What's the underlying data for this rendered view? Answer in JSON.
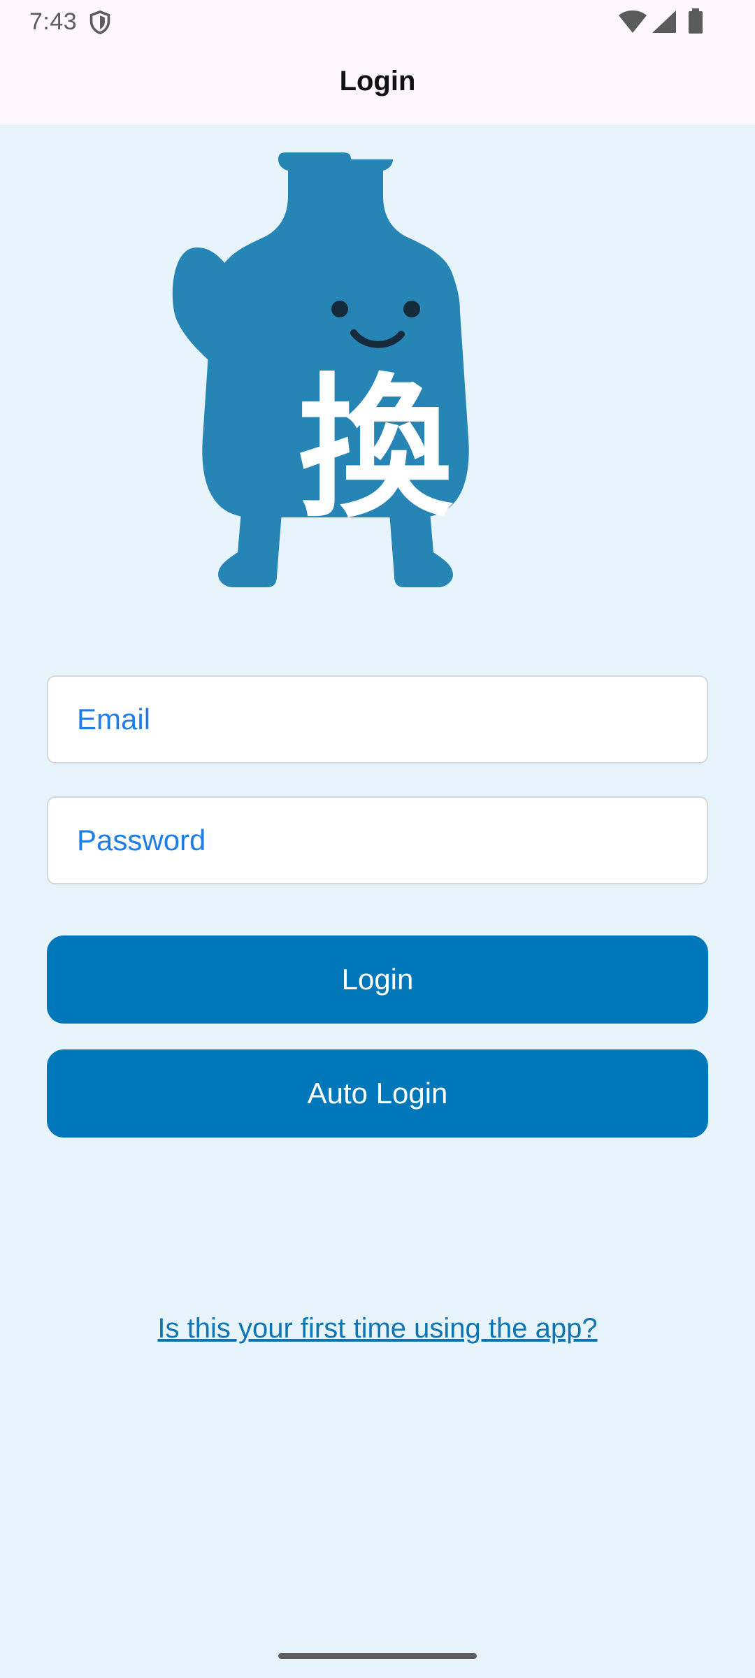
{
  "status_bar": {
    "time": "7:43",
    "icons": [
      "shield-icon",
      "wifi-icon",
      "cellular-signal-icon",
      "battery-icon"
    ]
  },
  "app_bar": {
    "title": "Login"
  },
  "mascot": {
    "glyph": "換",
    "color": "#2785b5"
  },
  "form": {
    "email_placeholder": "Email",
    "email_value": "",
    "password_placeholder": "Password",
    "password_value": "",
    "login_label": "Login",
    "auto_login_label": "Auto Login",
    "first_time_link": "Is this your first time using the app?"
  },
  "colors": {
    "background": "#e8f4fc",
    "header": "#fdf6fd",
    "primary_button": "#0077b8",
    "placeholder": "#1e7de6",
    "link": "#0f74b3"
  }
}
